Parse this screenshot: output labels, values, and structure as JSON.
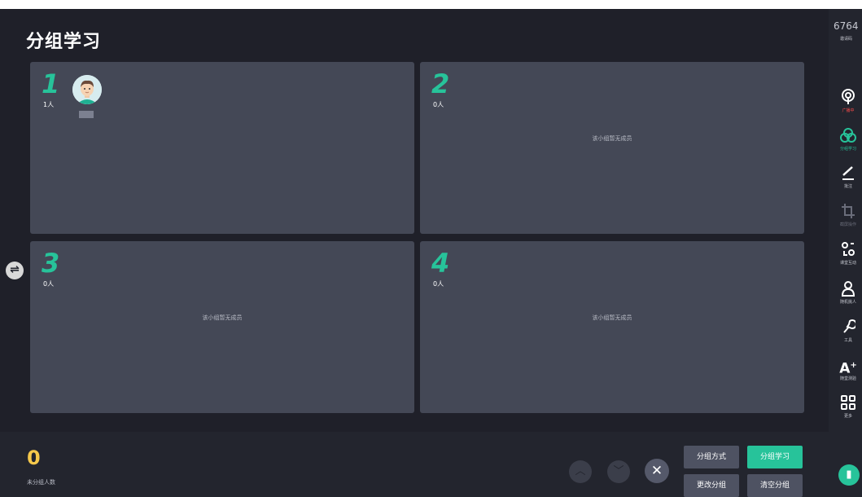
{
  "page": {
    "title": "分组学习"
  },
  "groups": [
    {
      "number": "1",
      "count": "1人",
      "empty_text": ""
    },
    {
      "number": "2",
      "count": "0人",
      "empty_text": "该小组暂无成员"
    },
    {
      "number": "3",
      "count": "0人",
      "empty_text": "该小组暂无成员"
    },
    {
      "number": "4",
      "count": "0人",
      "empty_text": "该小组暂无成员"
    }
  ],
  "switch_icon": "swap-arrows-icon",
  "footer": {
    "unassigned_count": "0",
    "unassigned_label": "未分组人数",
    "buttons": {
      "group_mode": "分组方式",
      "group_study": "分组学习",
      "change_group": "更改分组",
      "clear_group": "清空分组"
    }
  },
  "sidebar": {
    "invite_code": "6764",
    "invite_label": "邀请码",
    "tools": [
      {
        "label": "广播中",
        "icon": "broadcast-icon",
        "state": "alert"
      },
      {
        "label": "分组学习",
        "icon": "group-icon",
        "state": "active"
      },
      {
        "label": "批注",
        "icon": "pen-icon",
        "state": "normal"
      },
      {
        "label": "截屏操作",
        "icon": "crop-icon",
        "state": "disabled"
      },
      {
        "label": "课堂互动",
        "icon": "interaction-icon",
        "state": "normal"
      },
      {
        "label": "随机挑人",
        "icon": "person-icon",
        "state": "normal"
      },
      {
        "label": "工具",
        "icon": "wrench-icon",
        "state": "normal"
      },
      {
        "label": "随堂测验",
        "icon": "quiz-icon",
        "state": "normal"
      },
      {
        "label": "更多",
        "icon": "grid-icon",
        "state": "normal"
      }
    ]
  },
  "colors": {
    "accent": "#27c39a",
    "unassigned": "#f5c84b",
    "alert": "#ff4b4b",
    "panel": "#444856",
    "background": "#1f2029"
  }
}
